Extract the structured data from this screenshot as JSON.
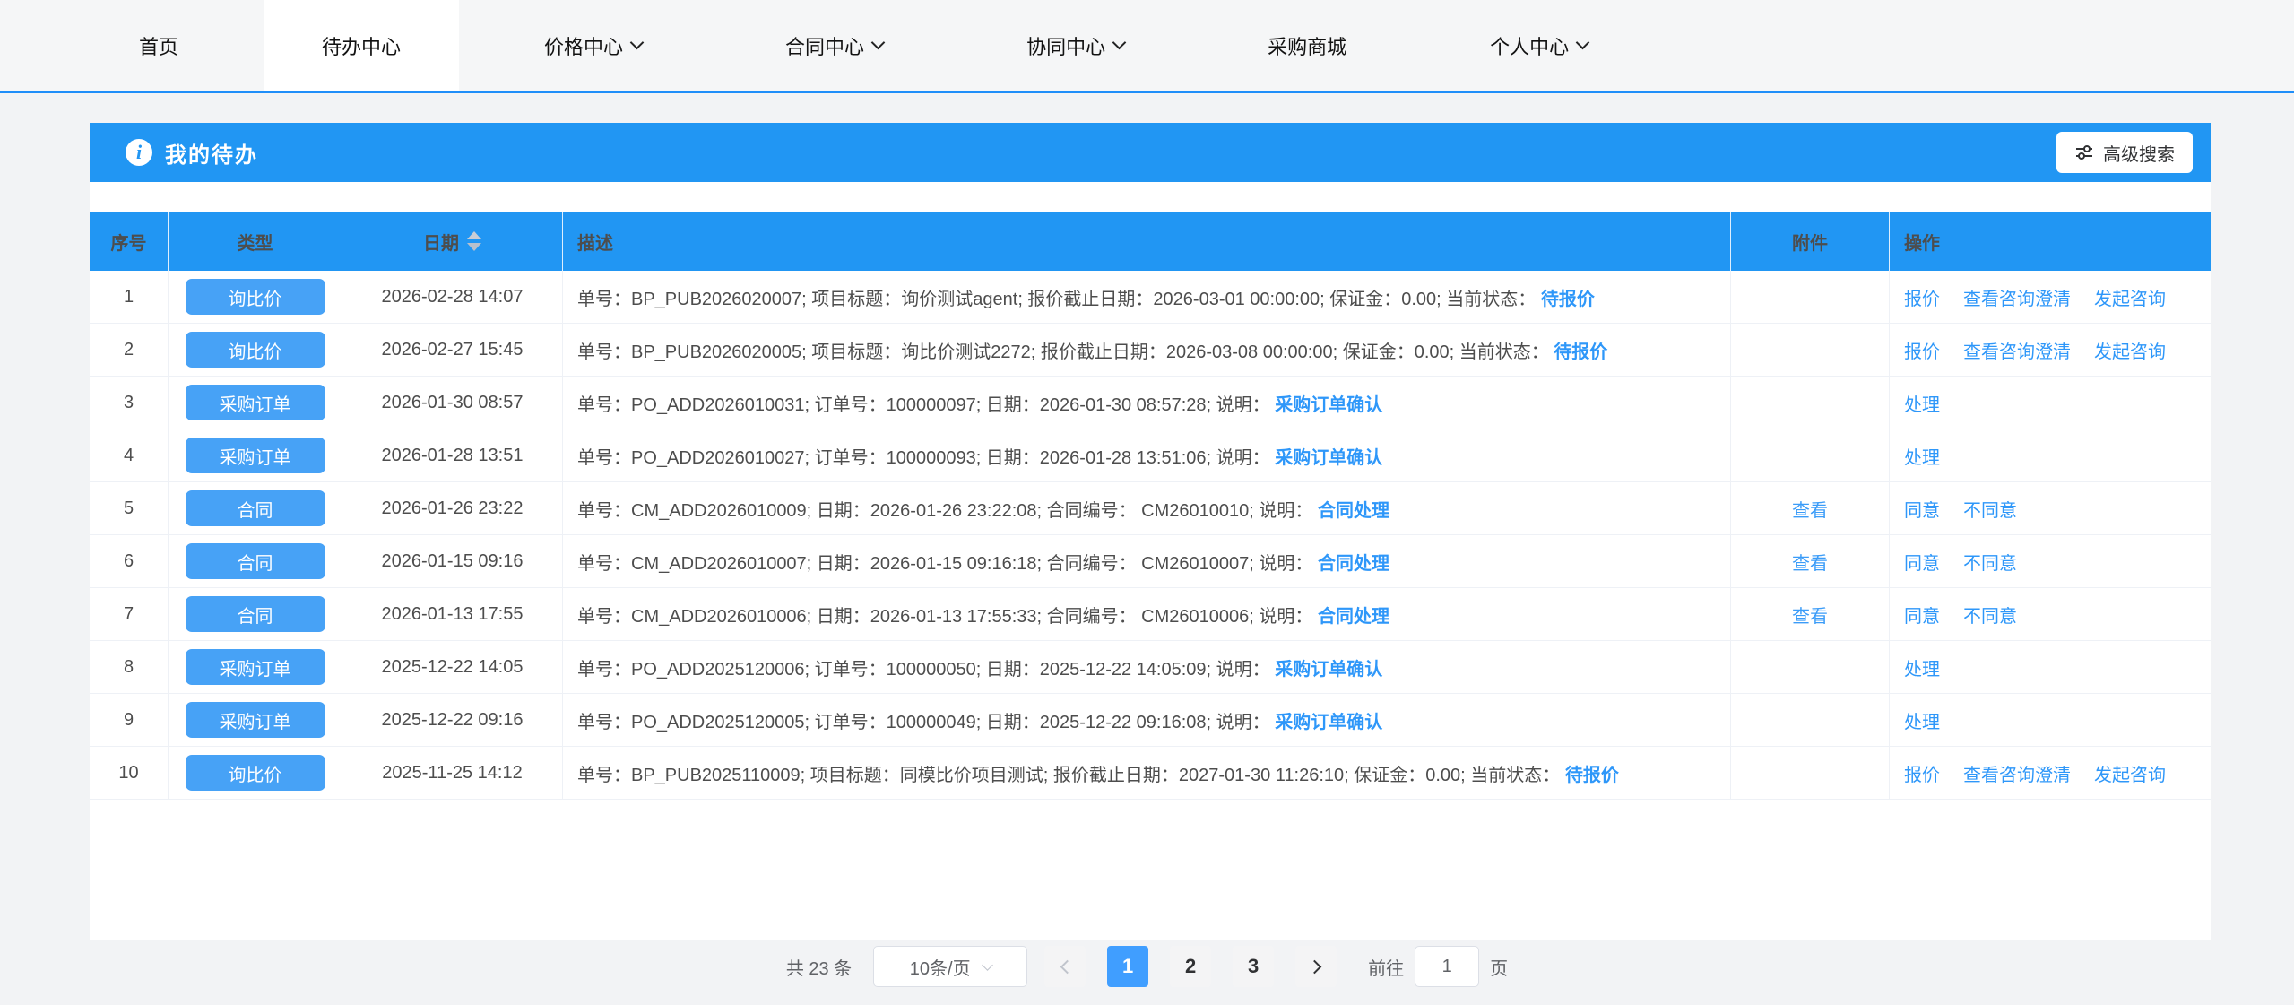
{
  "nav": {
    "items": [
      {
        "label": "首页",
        "active": false,
        "dropdown": false
      },
      {
        "label": "待办中心",
        "active": true,
        "dropdown": false
      },
      {
        "label": "价格中心",
        "active": false,
        "dropdown": true
      },
      {
        "label": "合同中心",
        "active": false,
        "dropdown": true
      },
      {
        "label": "协同中心",
        "active": false,
        "dropdown": true
      },
      {
        "label": "采购商城",
        "active": false,
        "dropdown": false
      },
      {
        "label": "个人中心",
        "active": false,
        "dropdown": true
      }
    ]
  },
  "panel": {
    "title": "我的待办",
    "info_icon": "i",
    "advanced_search_label": "高级搜索"
  },
  "colors": {
    "header_blue": "#2196f3",
    "badge_blue": "#47a2f6",
    "link_blue": "#2e97f9",
    "active_page_blue": "#409eff"
  },
  "table": {
    "headers": {
      "index": "序号",
      "type": "类型",
      "date": "日期",
      "desc": "描述",
      "attachment": "附件",
      "actions": "操作"
    },
    "rows": [
      {
        "index": "1",
        "type": "询比价",
        "date": "2026-02-28 14:07",
        "desc": "单号：BP_PUB2026020007; 项目标题：询价测试agent; 报价截止日期：2026-03-01 00:00:00; 保证金：0.00; 当前状态：",
        "desc_link": "待报价",
        "attachment": "",
        "actions": {
          "0": "报价",
          "1": "查看咨询澄清",
          "2": "发起咨询"
        }
      },
      {
        "index": "2",
        "type": "询比价",
        "date": "2026-02-27 15:45",
        "desc": "单号：BP_PUB2026020005; 项目标题：询比价测试2272; 报价截止日期：2026-03-08 00:00:00; 保证金：0.00; 当前状态：",
        "desc_link": "待报价",
        "attachment": "",
        "actions": {
          "0": "报价",
          "1": "查看咨询澄清",
          "2": "发起咨询"
        }
      },
      {
        "index": "3",
        "type": "采购订单",
        "date": "2026-01-30 08:57",
        "desc": "单号：PO_ADD2026010031; 订单号：100000097; 日期：2026-01-30 08:57:28; 说明：",
        "desc_link": "采购订单确认",
        "attachment": "",
        "actions": {
          "0": "处理"
        }
      },
      {
        "index": "4",
        "type": "采购订单",
        "date": "2026-01-28 13:51",
        "desc": "单号：PO_ADD2026010027; 订单号：100000093; 日期：2026-01-28 13:51:06; 说明：",
        "desc_link": "采购订单确认",
        "attachment": "",
        "actions": {
          "0": "处理"
        }
      },
      {
        "index": "5",
        "type": "合同",
        "date": "2026-01-26 23:22",
        "desc": "单号：CM_ADD2026010009; 日期：2026-01-26 23:22:08; 合同编号： CM26010010; 说明：",
        "desc_link": "合同处理",
        "attachment": "查看",
        "actions": {
          "0": "同意",
          "1": "不同意"
        }
      },
      {
        "index": "6",
        "type": "合同",
        "date": "2026-01-15 09:16",
        "desc": "单号：CM_ADD2026010007; 日期：2026-01-15 09:16:18; 合同编号： CM26010007; 说明：",
        "desc_link": "合同处理",
        "attachment": "查看",
        "actions": {
          "0": "同意",
          "1": "不同意"
        }
      },
      {
        "index": "7",
        "type": "合同",
        "date": "2026-01-13 17:55",
        "desc": "单号：CM_ADD2026010006; 日期：2026-01-13 17:55:33; 合同编号： CM26010006; 说明：",
        "desc_link": "合同处理",
        "attachment": "查看",
        "actions": {
          "0": "同意",
          "1": "不同意"
        }
      },
      {
        "index": "8",
        "type": "采购订单",
        "date": "2025-12-22 14:05",
        "desc": "单号：PO_ADD2025120006; 订单号：100000050; 日期：2025-12-22 14:05:09; 说明：",
        "desc_link": "采购订单确认",
        "attachment": "",
        "actions": {
          "0": "处理"
        }
      },
      {
        "index": "9",
        "type": "采购订单",
        "date": "2025-12-22 09:16",
        "desc": "单号：PO_ADD2025120005; 订单号：100000049; 日期：2025-12-22 09:16:08; 说明：",
        "desc_link": "采购订单确认",
        "attachment": "",
        "actions": {
          "0": "处理"
        }
      },
      {
        "index": "10",
        "type": "询比价",
        "date": "2025-11-25 14:12",
        "desc": "单号：BP_PUB2025110009; 项目标题：同模比价项目测试; 报价截止日期：2027-01-30 11:26:10; 保证金：0.00; 当前状态：",
        "desc_link": "待报价",
        "attachment": "",
        "actions": {
          "0": "报价",
          "1": "查看咨询澄清",
          "2": "发起咨询"
        }
      }
    ]
  },
  "pagination": {
    "total": "共 23 条",
    "page_size": "10条/页",
    "pages": {
      "0": "1",
      "1": "2",
      "2": "3"
    },
    "active_page": "1",
    "goto_label": "前往",
    "goto_value": "1",
    "goto_suffix": "页"
  }
}
